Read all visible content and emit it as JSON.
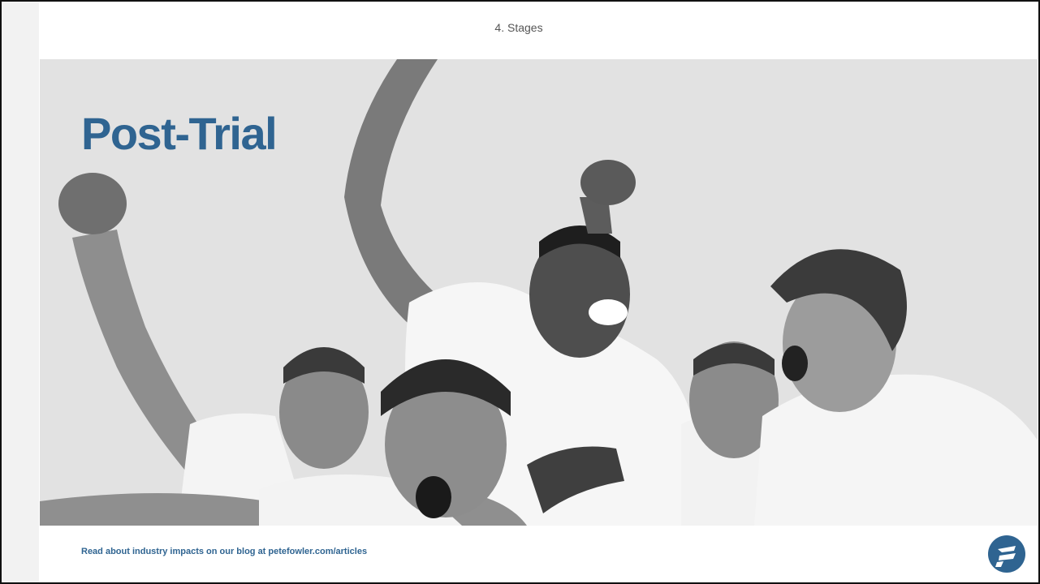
{
  "header": {
    "section_label": "4. Stages"
  },
  "slide": {
    "title": "Post-Trial",
    "photo_icon": "celebrating-players-photo"
  },
  "footer": {
    "link_text": "Read about industry impacts on our blog at petefowler.com/articles",
    "logo_icon": "pete-fowler-logo-icon"
  },
  "colors": {
    "title": "#2f6491",
    "footer_text": "#2f6491",
    "logo": "#2f6491",
    "header_text": "#555555"
  }
}
